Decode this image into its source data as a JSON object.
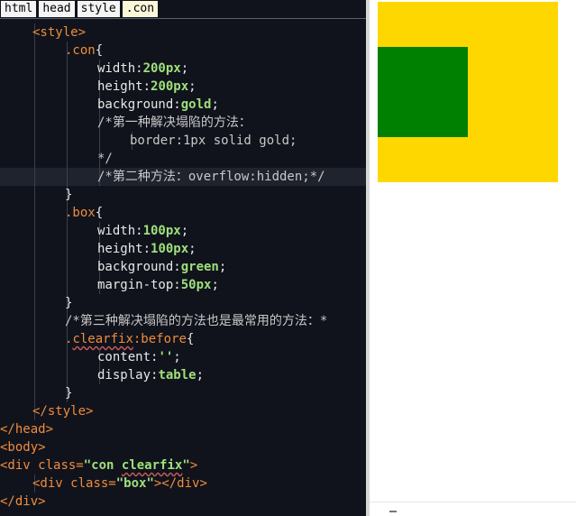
{
  "breadcrumb": [
    "html",
    "head",
    "style",
    ".con"
  ],
  "code_lines": [
    {
      "indent": 1,
      "tokens": [
        [
          "tag",
          "<style>"
        ]
      ]
    },
    {
      "indent": 2,
      "tokens": [
        [
          "sel",
          ".con"
        ],
        [
          "punct",
          "{"
        ]
      ]
    },
    {
      "indent": 3,
      "tokens": [
        [
          "prop",
          "width:"
        ],
        [
          "val",
          "200px"
        ],
        [
          "punct",
          ";"
        ]
      ]
    },
    {
      "indent": 3,
      "tokens": [
        [
          "prop",
          "height:"
        ],
        [
          "val",
          "200px"
        ],
        [
          "punct",
          ";"
        ]
      ]
    },
    {
      "indent": 3,
      "tokens": [
        [
          "prop",
          "background:"
        ],
        [
          "val",
          "gold"
        ],
        [
          "punct",
          ";"
        ]
      ]
    },
    {
      "indent": 3,
      "tokens": [
        [
          "cm",
          "/*第一种解决塌陷的方法："
        ]
      ]
    },
    {
      "indent": 4,
      "tokens": [
        [
          "cm",
          "border:1px solid gold;"
        ]
      ]
    },
    {
      "indent": 3,
      "tokens": [
        [
          "cm",
          "*/"
        ]
      ]
    },
    {
      "indent": 3,
      "highlight": true,
      "tokens": [
        [
          "cm",
          "/*第二种方法：overflow:hidden;*/"
        ]
      ]
    },
    {
      "indent": 2,
      "tokens": [
        [
          "punct",
          "}"
        ]
      ]
    },
    {
      "indent": 2,
      "tokens": [
        [
          "sel",
          ".box"
        ],
        [
          "punct",
          "{"
        ]
      ]
    },
    {
      "indent": 3,
      "tokens": [
        [
          "prop",
          "width:"
        ],
        [
          "val",
          "100px"
        ],
        [
          "punct",
          ";"
        ]
      ]
    },
    {
      "indent": 3,
      "tokens": [
        [
          "prop",
          "height:"
        ],
        [
          "val",
          "100px"
        ],
        [
          "punct",
          ";"
        ]
      ]
    },
    {
      "indent": 3,
      "tokens": [
        [
          "prop",
          "background:"
        ],
        [
          "val",
          "green"
        ],
        [
          "punct",
          ";"
        ]
      ]
    },
    {
      "indent": 3,
      "tokens": [
        [
          "prop",
          "margin-top:"
        ],
        [
          "val",
          "50px"
        ],
        [
          "punct",
          ";"
        ]
      ]
    },
    {
      "indent": 2,
      "tokens": [
        [
          "punct",
          "}"
        ]
      ]
    },
    {
      "indent": 2,
      "tokens": [
        [
          "cm",
          "/*第三种解决塌陷的方法也是最常用的方法：*"
        ]
      ]
    },
    {
      "indent": 2,
      "tokens": [
        [
          "sel",
          "."
        ],
        [
          "sel squig",
          "clearfix"
        ],
        [
          "sel",
          ":before"
        ],
        [
          "punct",
          "{"
        ]
      ]
    },
    {
      "indent": 3,
      "tokens": [
        [
          "prop",
          "content:"
        ],
        [
          "val",
          "''"
        ],
        [
          "punct",
          ";"
        ]
      ]
    },
    {
      "indent": 3,
      "tokens": [
        [
          "prop",
          "display:"
        ],
        [
          "val",
          "table"
        ],
        [
          "punct",
          ";"
        ]
      ]
    },
    {
      "indent": 2,
      "tokens": [
        [
          "punct",
          "}"
        ]
      ]
    },
    {
      "indent": 1,
      "tokens": [
        [
          "tag",
          "</style>"
        ]
      ]
    },
    {
      "indent": 0,
      "tokens": [
        [
          "tag",
          "</head>"
        ]
      ]
    },
    {
      "indent": 0,
      "tokens": [
        [
          "tag",
          "<body>"
        ]
      ]
    },
    {
      "indent": 0,
      "tokens": [
        [
          "tag",
          "<div "
        ],
        [
          "attr",
          "class="
        ],
        [
          "str",
          "\"con "
        ],
        [
          "str squig",
          "clearfix"
        ],
        [
          "str",
          "\""
        ],
        [
          "tag",
          ">"
        ]
      ]
    },
    {
      "indent": 1,
      "tokens": [
        [
          "tag",
          "<div "
        ],
        [
          "attr",
          "class="
        ],
        [
          "str",
          "\"box\""
        ],
        [
          "tag",
          "></div>"
        ]
      ]
    },
    {
      "indent": 0,
      "tokens": [
        [
          "tag",
          "</div>"
        ]
      ]
    }
  ],
  "preview": {
    "con_color": "#ffd700",
    "box_color": "#008000"
  }
}
